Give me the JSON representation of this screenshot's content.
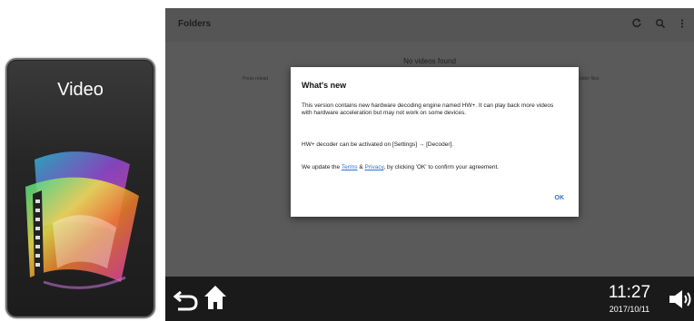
{
  "launcher_tile": {
    "title": "Video",
    "icon": "film-reel-icon"
  },
  "app_bar": {
    "title": "Folders",
    "icons": [
      "refresh-icon",
      "search-icon",
      "overflow-menu-icon"
    ]
  },
  "content": {
    "empty_message": "No videos found",
    "hint_left": "Press reload",
    "hint_right": "older files"
  },
  "dialog": {
    "title": "What's new",
    "paragraph1": "This version contains new hardware decoding engine named HW+. It can play back more videos with hardware acceleration but may not work on some devices.",
    "paragraph2": "HW+ decoder can be activated on [Settings] → [Decoder].",
    "p3_before": "We update the ",
    "terms_link": "Terms",
    "p3_mid": " & ",
    "privacy_link": "Privacy",
    "p3_after": ", by clicking 'OK' to confirm your agreement.",
    "ok_label": "OK"
  },
  "system_bar": {
    "time": "11:27",
    "date": "2017/10/11",
    "icons": [
      "back-icon",
      "home-icon",
      "volume-icon"
    ]
  },
  "colors": {
    "link": "#2d6fd6",
    "dim_overlay": "#5a5a5a",
    "nav_bar": "#1a1a1a"
  }
}
